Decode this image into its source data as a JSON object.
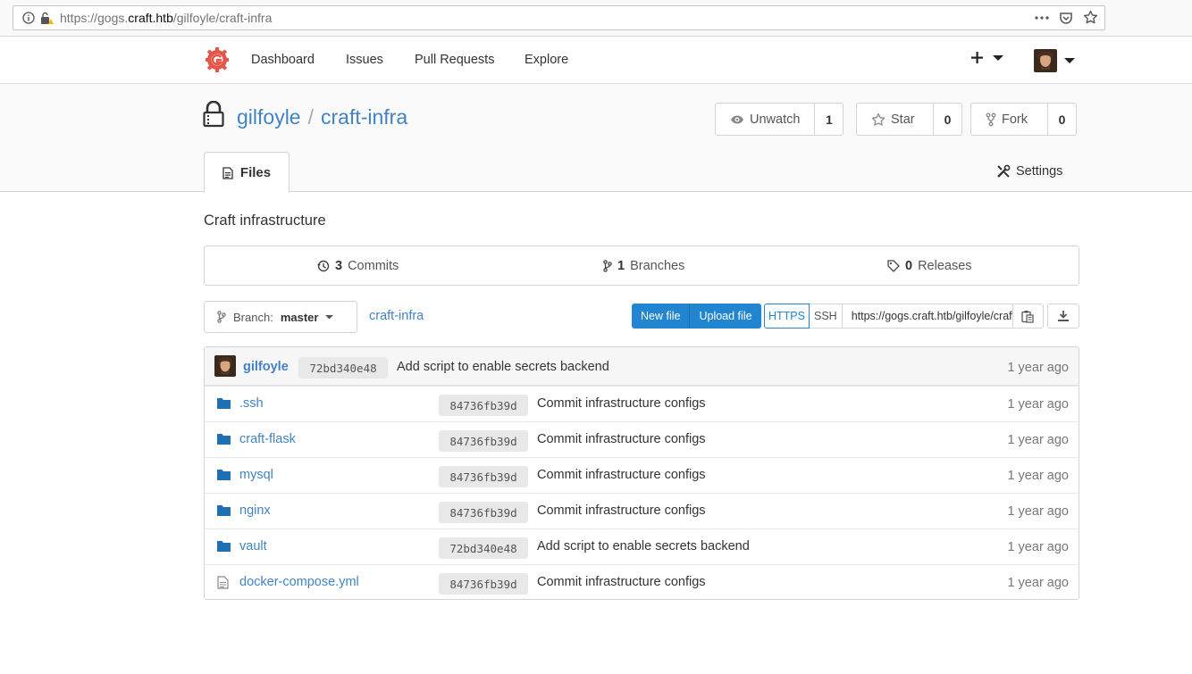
{
  "browser": {
    "url_prefix": "https://gogs.",
    "url_host": "craft.htb",
    "url_path": "/gilfoyle/craft-infra"
  },
  "nav": {
    "items": [
      "Dashboard",
      "Issues",
      "Pull Requests",
      "Explore"
    ]
  },
  "repo": {
    "owner": "gilfoyle",
    "separator": "/",
    "name": "craft-infra",
    "watch_label": "Unwatch",
    "watch_count": "1",
    "star_label": "Star",
    "star_count": "0",
    "fork_label": "Fork",
    "fork_count": "0",
    "tab_files": "Files",
    "tab_settings": "Settings",
    "description": "Craft infrastructure"
  },
  "stats": {
    "commits_count": "3",
    "commits_label": "Commits",
    "branches_count": "1",
    "branches_label": "Branches",
    "releases_count": "0",
    "releases_label": "Releases"
  },
  "toolbar": {
    "branch_label": "Branch:",
    "branch_name": "master",
    "breadcrumb": "craft-infra",
    "new_file": "New file",
    "upload_file": "Upload file",
    "https": "HTTPS",
    "ssh": "SSH",
    "clone_url": "https://gogs.craft.htb/gilfoyle/craft-infra.git"
  },
  "latest_commit": {
    "author": "gilfoyle",
    "sha": "72bd340e48",
    "message": "Add script to enable secrets backend",
    "age": "1 year ago"
  },
  "files": [
    {
      "name": ".ssh",
      "type": "folder",
      "sha": "84736fb39d",
      "message": "Commit infrastructure configs",
      "age": "1 year ago"
    },
    {
      "name": "craft-flask",
      "type": "folder",
      "sha": "84736fb39d",
      "message": "Commit infrastructure configs",
      "age": "1 year ago"
    },
    {
      "name": "mysql",
      "type": "folder",
      "sha": "84736fb39d",
      "message": "Commit infrastructure configs",
      "age": "1 year ago"
    },
    {
      "name": "nginx",
      "type": "folder",
      "sha": "84736fb39d",
      "message": "Commit infrastructure configs",
      "age": "1 year ago"
    },
    {
      "name": "vault",
      "type": "folder",
      "sha": "72bd340e48",
      "message": "Add script to enable secrets backend",
      "age": "1 year ago"
    },
    {
      "name": "docker-compose.yml",
      "type": "file",
      "sha": "84736fb39d",
      "message": "Commit infrastructure configs",
      "age": "1 year ago"
    }
  ],
  "colors": {
    "link": "#4183c4",
    "primary_button": "#2185d0",
    "folder_icon": "#1e6fb3",
    "gogs_logo": "#e4554a"
  },
  "icons": [
    "info-icon",
    "lock-icon",
    "more-icon",
    "pocket-icon",
    "bookmark-star-icon",
    "gogs-logo",
    "plus-icon",
    "caret-down-icon",
    "avatar",
    "repo-lock-icon",
    "eye-icon",
    "star-icon",
    "fork-icon",
    "file-text-icon",
    "tools-icon",
    "history-icon",
    "branch-icon",
    "tag-icon",
    "clipboard-icon",
    "download-icon",
    "folder-icon",
    "file-icon"
  ]
}
